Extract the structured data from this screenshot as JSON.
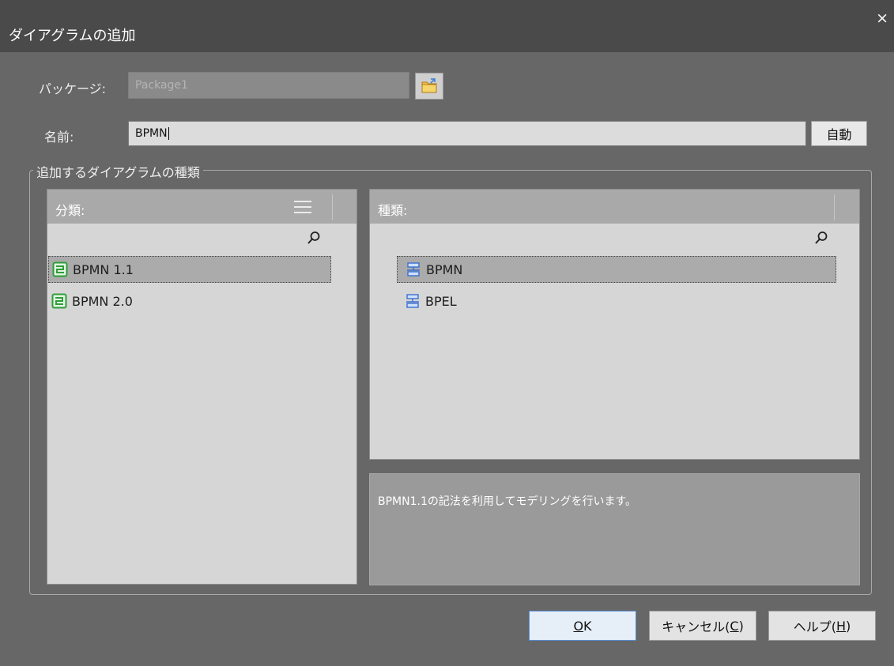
{
  "window": {
    "title": "ダイアグラムの追加",
    "close_glyph": "×"
  },
  "package": {
    "label": "パッケージ:",
    "value": "Package1",
    "browse_icon": "folder-icon"
  },
  "name": {
    "label": "名前:",
    "value": "BPMN",
    "auto_button": "自動"
  },
  "group": {
    "label": "追加するダイアグラムの種類"
  },
  "category_panel": {
    "header": "分類:",
    "items": [
      {
        "label": "BPMN 1.1",
        "selected": true
      },
      {
        "label": "BPMN 2.0",
        "selected": false
      }
    ]
  },
  "type_panel": {
    "header": "種類:",
    "items": [
      {
        "label": "BPMN",
        "selected": true
      },
      {
        "label": "BPEL",
        "selected": false
      }
    ]
  },
  "description": "BPMN1.1の記法を利用してモデリングを行います。",
  "buttons": {
    "ok": {
      "prefix": "",
      "mnemonic": "O",
      "suffix": "K"
    },
    "cancel": {
      "prefix": "キャンセル(",
      "mnemonic": "C",
      "suffix": ")"
    },
    "help": {
      "prefix": "ヘルプ(",
      "mnemonic": "H",
      "suffix": ")"
    }
  },
  "colors": {
    "titlebar": "#4a4a4a",
    "background": "#676767",
    "panel": "#d6d6d6",
    "panel_header": "#a9a9a9",
    "selected_row": "#ababab",
    "category_icon": "#2f9e3a",
    "type_icon": "#3b6fd0"
  }
}
